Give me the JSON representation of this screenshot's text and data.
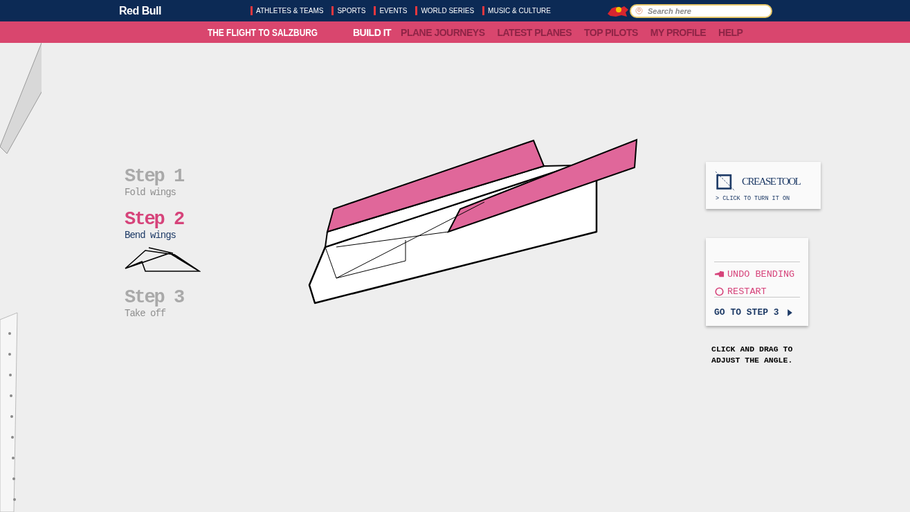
{
  "header": {
    "logo": "Red Bull",
    "nav": [
      {
        "label": "ATHLETES & TEAMS"
      },
      {
        "label": "SPORTS"
      },
      {
        "label": "EVENTS"
      },
      {
        "label": "WORLD SERIES"
      },
      {
        "label": "MUSIC & CULTURE"
      }
    ],
    "search": {
      "placeholder": "Search here"
    }
  },
  "subnav": {
    "title": "THE FLIGHT TO SALZBURG",
    "items": [
      {
        "label": "BUILD IT",
        "selected": true
      },
      {
        "label": "PLANE JOURNEYS",
        "selected": false
      },
      {
        "label": "LATEST PLANES",
        "selected": false
      },
      {
        "label": "TOP PILOTS",
        "selected": false
      },
      {
        "label": "MY PROFILE",
        "selected": false
      },
      {
        "label": "HELP",
        "selected": false
      }
    ]
  },
  "steps": [
    {
      "title": "Step 1",
      "subtitle": "Fold wings",
      "selected": false
    },
    {
      "title": "Step 2",
      "subtitle": "Bend wings",
      "selected": true
    },
    {
      "title": "Step 3",
      "subtitle": "Take off",
      "selected": false
    }
  ],
  "crease_tool": {
    "title": "CREASE TOOL",
    "hint": "> CLICK TO TURN IT ON"
  },
  "actions": [
    {
      "kind": "undo",
      "label": "UNDO BENDING"
    },
    {
      "kind": "restart",
      "label": "RESTART"
    }
  ],
  "next": {
    "label": "GO TO STEP 3"
  },
  "instruction": "CLICK AND DRAG TO ADJUST THE ANGLE."
}
